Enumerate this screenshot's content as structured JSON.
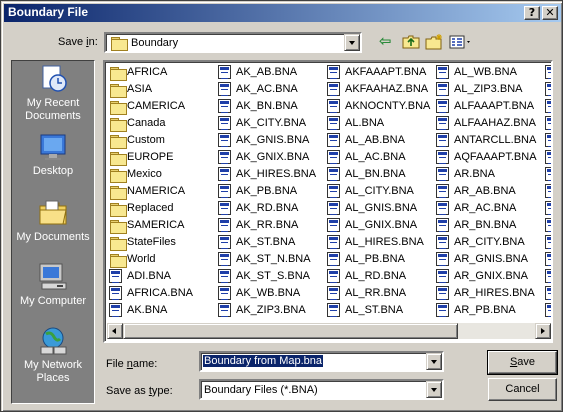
{
  "window": {
    "title": "Boundary File",
    "help_glyph": "?",
    "close_glyph": "✕"
  },
  "save_in": {
    "label": "Save in:",
    "value": "Boundary"
  },
  "toolbar": {
    "back_icon": "back-arrow-icon",
    "up_icon": "up-one-level-icon",
    "new_folder_icon": "new-folder-icon",
    "view_icon": "view-menu-icon"
  },
  "places": [
    {
      "label": "My Recent Documents",
      "icon": "recent-documents-icon"
    },
    {
      "label": "Desktop",
      "icon": "desktop-icon"
    },
    {
      "label": "My Documents",
      "icon": "my-documents-icon"
    },
    {
      "label": "My Computer",
      "icon": "my-computer-icon"
    },
    {
      "label": "My Network Places",
      "icon": "network-places-icon"
    }
  ],
  "files": {
    "columns": [
      [
        {
          "name": "AFRICA",
          "type": "folder"
        },
        {
          "name": "ASIA",
          "type": "folder"
        },
        {
          "name": "CAMERICA",
          "type": "folder"
        },
        {
          "name": "Canada",
          "type": "folder"
        },
        {
          "name": "Custom",
          "type": "folder"
        },
        {
          "name": "EUROPE",
          "type": "folder"
        },
        {
          "name": "Mexico",
          "type": "folder"
        },
        {
          "name": "NAMERICA",
          "type": "folder"
        },
        {
          "name": "Replaced",
          "type": "folder"
        },
        {
          "name": "SAMERICA",
          "type": "folder"
        },
        {
          "name": "StateFiles",
          "type": "folder"
        },
        {
          "name": "World",
          "type": "folder"
        },
        {
          "name": "ADI.BNA",
          "type": "bna"
        },
        {
          "name": "AFRICA.BNA",
          "type": "bna"
        },
        {
          "name": "AK.BNA",
          "type": "bna"
        }
      ],
      [
        {
          "name": "AK_AB.BNA",
          "type": "bna"
        },
        {
          "name": "AK_AC.BNA",
          "type": "bna"
        },
        {
          "name": "AK_BN.BNA",
          "type": "bna"
        },
        {
          "name": "AK_CITY.BNA",
          "type": "bna"
        },
        {
          "name": "AK_GNIS.BNA",
          "type": "bna"
        },
        {
          "name": "AK_GNIX.BNA",
          "type": "bna"
        },
        {
          "name": "AK_HIRES.BNA",
          "type": "bna"
        },
        {
          "name": "AK_PB.BNA",
          "type": "bna"
        },
        {
          "name": "AK_RD.BNA",
          "type": "bna"
        },
        {
          "name": "AK_RR.BNA",
          "type": "bna"
        },
        {
          "name": "AK_ST.BNA",
          "type": "bna"
        },
        {
          "name": "AK_ST_N.BNA",
          "type": "bna"
        },
        {
          "name": "AK_ST_S.BNA",
          "type": "bna"
        },
        {
          "name": "AK_WB.BNA",
          "type": "bna"
        },
        {
          "name": "AK_ZIP3.BNA",
          "type": "bna"
        }
      ],
      [
        {
          "name": "AKFAAAPT.BNA",
          "type": "bna"
        },
        {
          "name": "AKFAAHAZ.BNA",
          "type": "bna"
        },
        {
          "name": "AKNOCNTY.BNA",
          "type": "bna"
        },
        {
          "name": "AL.BNA",
          "type": "bna"
        },
        {
          "name": "AL_AB.BNA",
          "type": "bna"
        },
        {
          "name": "AL_AC.BNA",
          "type": "bna"
        },
        {
          "name": "AL_BN.BNA",
          "type": "bna"
        },
        {
          "name": "AL_CITY.BNA",
          "type": "bna"
        },
        {
          "name": "AL_GNIS.BNA",
          "type": "bna"
        },
        {
          "name": "AL_GNIX.BNA",
          "type": "bna"
        },
        {
          "name": "AL_HIRES.BNA",
          "type": "bna"
        },
        {
          "name": "AL_PB.BNA",
          "type": "bna"
        },
        {
          "name": "AL_RD.BNA",
          "type": "bna"
        },
        {
          "name": "AL_RR.BNA",
          "type": "bna"
        },
        {
          "name": "AL_ST.BNA",
          "type": "bna"
        }
      ],
      [
        {
          "name": "AL_WB.BNA",
          "type": "bna"
        },
        {
          "name": "AL_ZIP3.BNA",
          "type": "bna"
        },
        {
          "name": "ALFAAAPT.BNA",
          "type": "bna"
        },
        {
          "name": "ALFAAHAZ.BNA",
          "type": "bna"
        },
        {
          "name": "ANTARCLL.BNA",
          "type": "bna"
        },
        {
          "name": "AQFAAAPT.BNA",
          "type": "bna"
        },
        {
          "name": "AR.BNA",
          "type": "bna"
        },
        {
          "name": "AR_AB.BNA",
          "type": "bna"
        },
        {
          "name": "AR_AC.BNA",
          "type": "bna"
        },
        {
          "name": "AR_BN.BNA",
          "type": "bna"
        },
        {
          "name": "AR_CITY.BNA",
          "type": "bna"
        },
        {
          "name": "AR_GNIS.BNA",
          "type": "bna"
        },
        {
          "name": "AR_GNIX.BNA",
          "type": "bna"
        },
        {
          "name": "AR_HIRES.BNA",
          "type": "bna"
        },
        {
          "name": "AR_PB.BNA",
          "type": "bna"
        }
      ]
    ]
  },
  "file_name": {
    "label": "File name:",
    "value": "Boundary from Map.bna"
  },
  "save_as_type": {
    "label": "Save as type:",
    "value": "Boundary Files (*.BNA)"
  },
  "buttons": {
    "save": "Save",
    "cancel": "Cancel"
  },
  "colors": {
    "title_start": "#0a246a",
    "title_end": "#a6caf0",
    "places_bar": "#808080",
    "face": "#d4d0c8"
  }
}
